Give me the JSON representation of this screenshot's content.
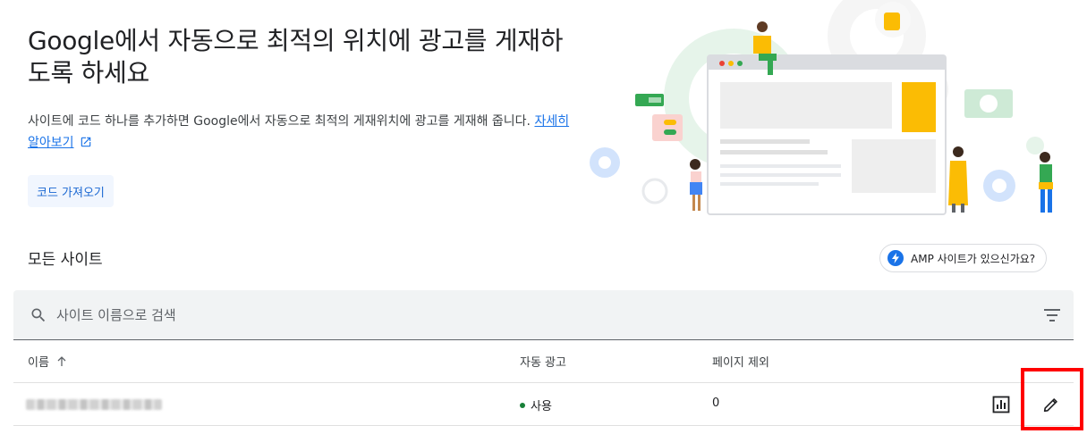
{
  "header": {
    "title": "Google에서 자동으로 최적의 위치에 광고를 게재하도록 하세요",
    "description": "사이트에 코드 하나를 추가하면 Google에서 자동으로 최적의 게재위치에 광고를 게재해 줍니다.",
    "learn_more": "자세히 알아보기",
    "get_code_label": "코드 가져오기"
  },
  "sites": {
    "section_title": "모든 사이트",
    "amp_button_label": "AMP 사이트가 있으신가요?",
    "search_placeholder": "사이트 이름으로 검색",
    "columns": [
      "이름",
      "자동 광고",
      "페이지 제외"
    ],
    "rows": [
      {
        "name": "",
        "auto_ads": "사용",
        "excluded_pages": "0"
      }
    ]
  },
  "colors": {
    "accent": "#1a73e8",
    "status_on": "#188038",
    "highlight": "#ff0000"
  },
  "icons": [
    "external-link-icon",
    "bolt-icon",
    "search-icon",
    "filter-icon",
    "arrow-up-icon",
    "bar-chart-icon",
    "pencil-icon"
  ]
}
